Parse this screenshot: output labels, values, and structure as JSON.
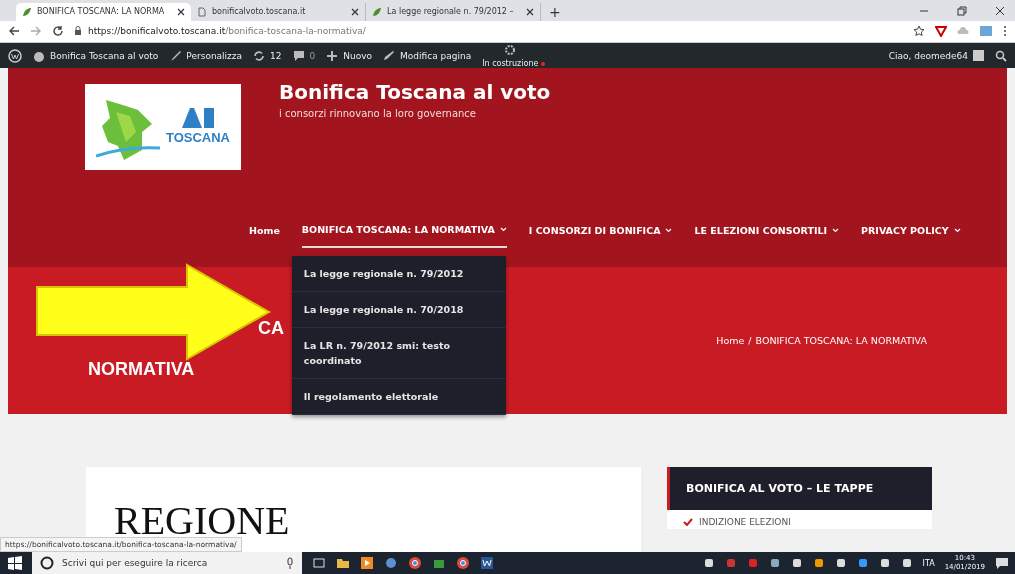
{
  "browser": {
    "tabs": [
      {
        "title": "BONIFICA TOSCANA: LA NORMA",
        "selected": true
      },
      {
        "title": "bonificalvoto.toscana.it",
        "selected": false
      },
      {
        "title": "La legge regionale n. 79/2012 – ",
        "selected": false
      }
    ],
    "new_tab": "+",
    "url_host": "https://bonificalvoto.toscana.it",
    "url_path": "/bonifica-toscana-la-normativa/"
  },
  "admin_bar": {
    "items": [
      {
        "label": "Bonifica Toscana al voto",
        "kind": "site"
      },
      {
        "label": "Personalizza",
        "kind": "brush"
      },
      {
        "label": "12",
        "kind": "updates"
      },
      {
        "label": "0",
        "kind": "comments"
      },
      {
        "label": "Nuovo",
        "kind": "new"
      },
      {
        "label": "Modifica pagina",
        "kind": "edit"
      }
    ],
    "status": "In costruzione",
    "greeting": "Ciao, deomede64"
  },
  "site": {
    "logo_text": "TOSCANA",
    "title": "Bonifica Toscana al voto",
    "tagline": "i consorzi rinnovano la loro governance"
  },
  "nav": [
    {
      "label": "Home",
      "submenu": false,
      "selected": false
    },
    {
      "label": "BONIFICA TOSCANA: LA NORMATIVA",
      "submenu": true,
      "selected": true
    },
    {
      "label": "I CONSORZI DI BONIFICA",
      "submenu": true,
      "selected": false
    },
    {
      "label": "LE ELEZIONI CONSORTILI",
      "submenu": true,
      "selected": false
    },
    {
      "label": "PRIVACY POLICY",
      "submenu": true,
      "selected": false
    }
  ],
  "dropdown": [
    "La legge regionale n. 79/2012",
    "La legge regionale n. 70/2018",
    "La LR n. 79/2012 smi: testo coordinato",
    "Il regolamento elettorale"
  ],
  "page_title": {
    "line_1": "CA",
    "line_2": "NORMATIVA"
  },
  "breadcrumb": {
    "home": "Home",
    "separator": "/",
    "current": "BONIFICA TOSCANA: LA NORMATIVA"
  },
  "content": {
    "heading": "REGIONE"
  },
  "sidebar": {
    "widget_title": "BONIFICA AL VOTO – LE TAPPE",
    "items": [
      "INDIZIONE ELEZIONI"
    ]
  },
  "status_url": "https://bonificalvoto.toscana.it/bonifica-toscana-la-normativa/",
  "taskbar": {
    "search_placeholder": "Scrivi qui per eseguire la ricerca",
    "language": "ITA",
    "time": "10:43",
    "date": "14/01/2019"
  }
}
